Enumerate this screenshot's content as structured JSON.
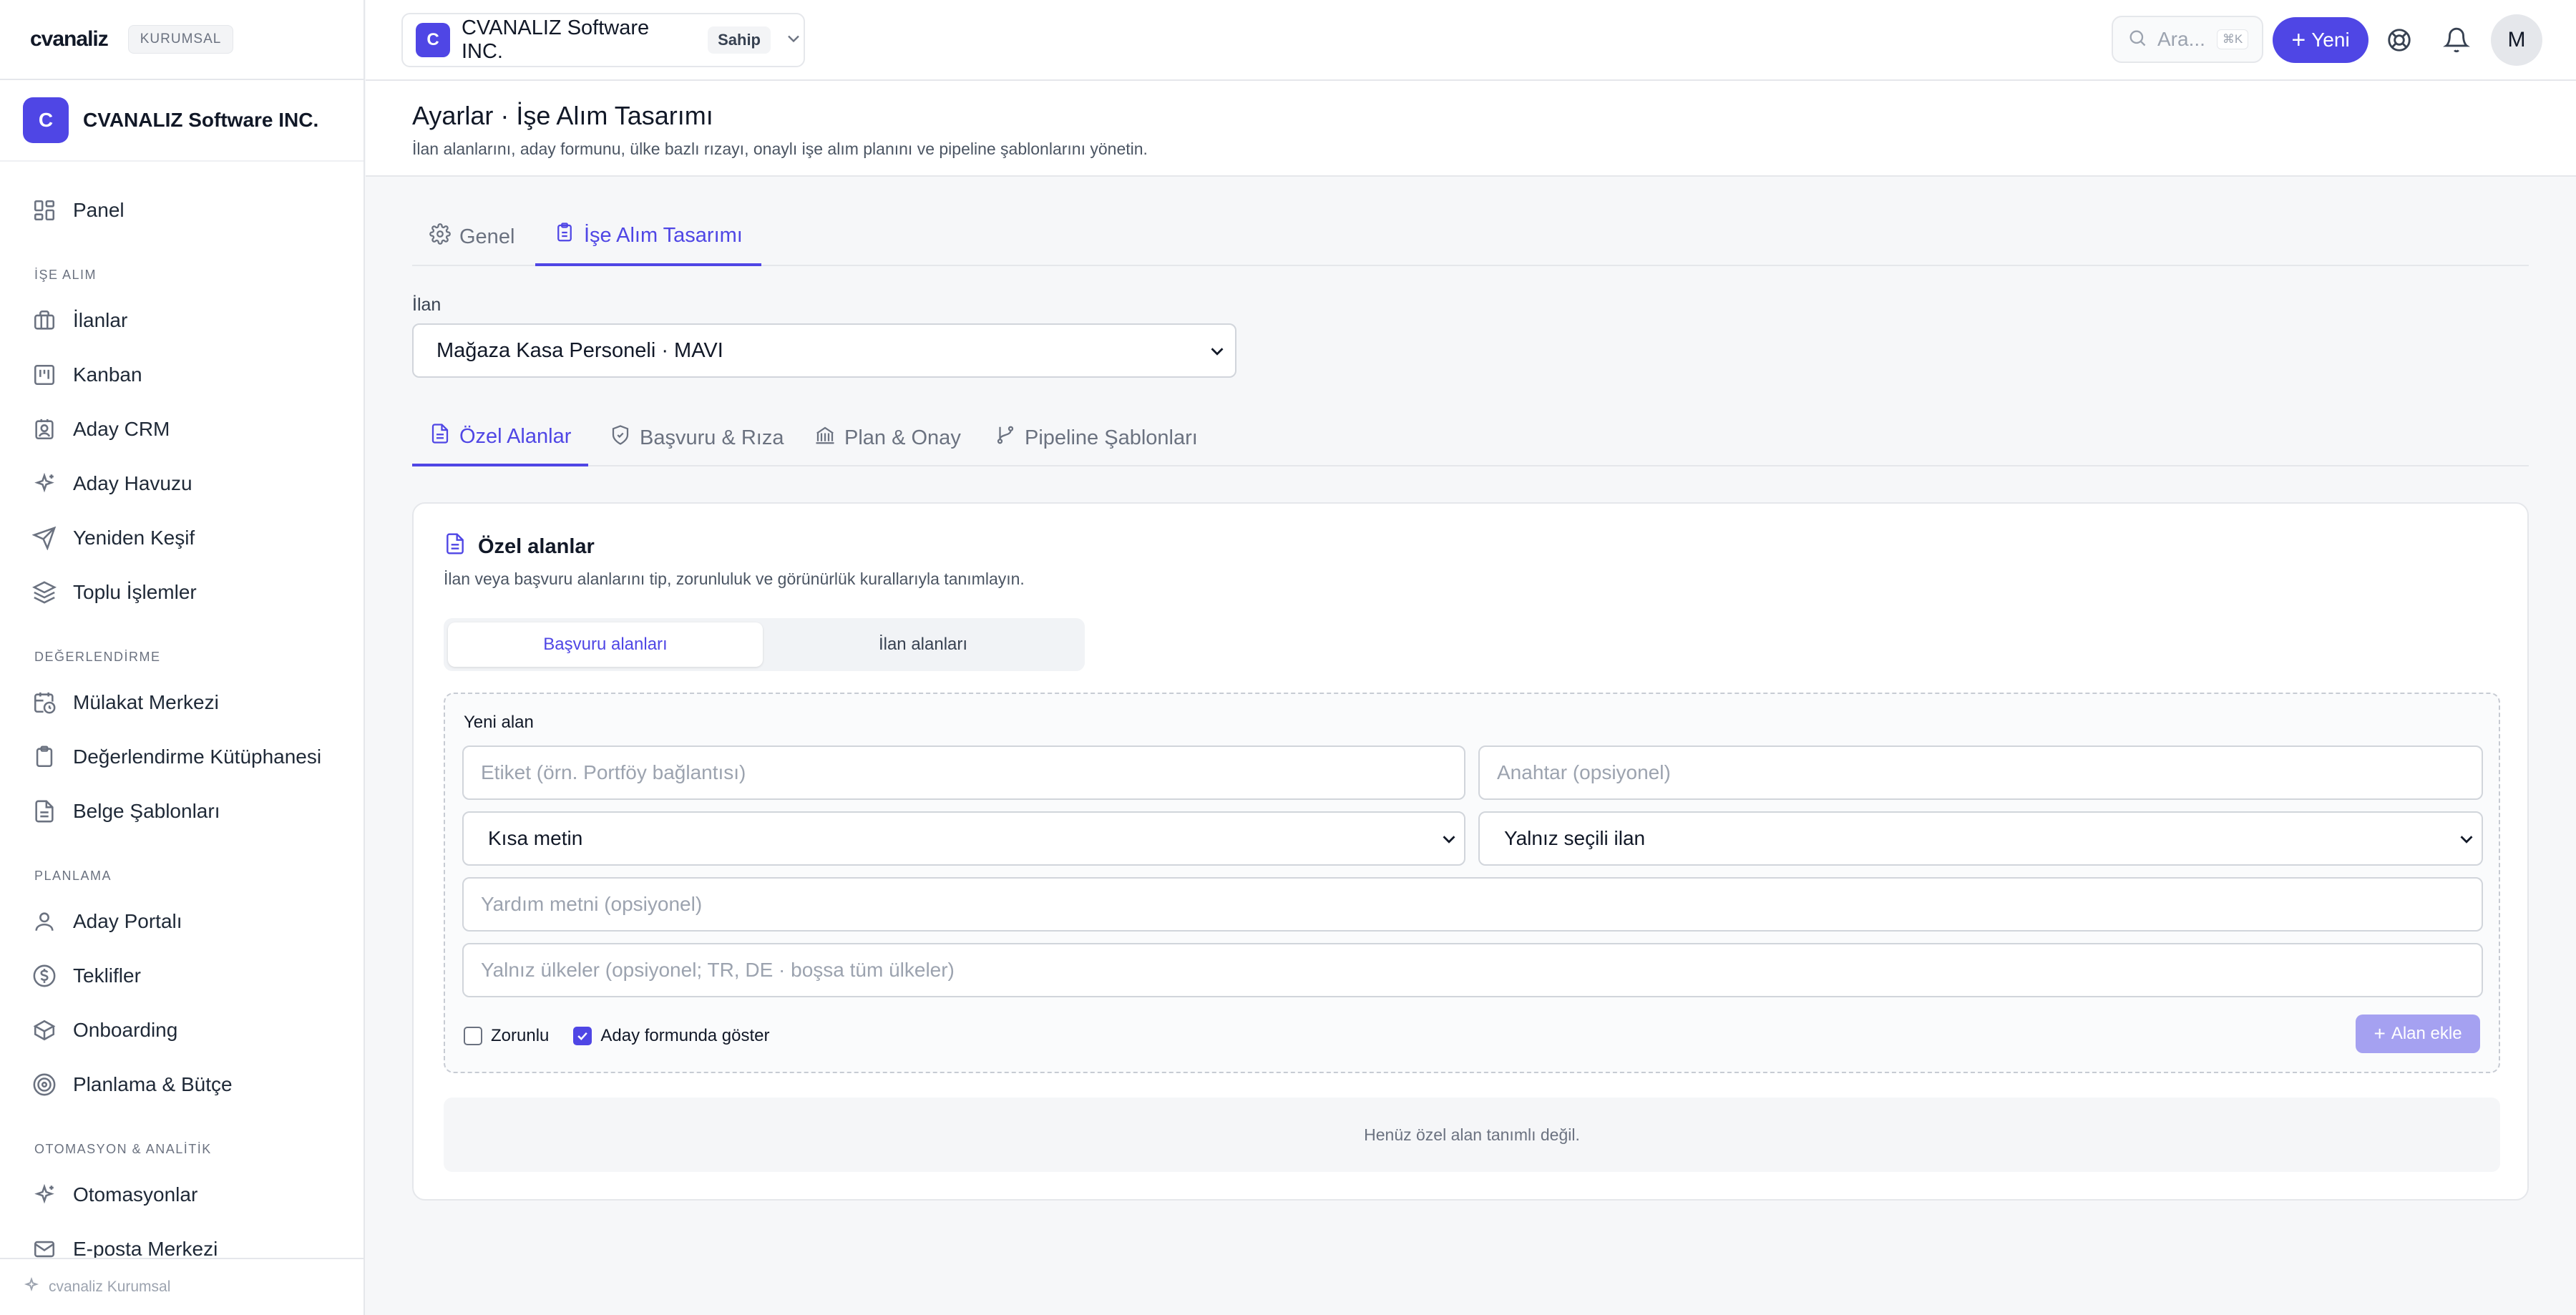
{
  "brand": {
    "logo_text": "cvanaliz",
    "badge": "KURUMSAL"
  },
  "org": {
    "initial": "C",
    "name": "CVANALIZ Software INC."
  },
  "sidebar": {
    "items": [
      {
        "label": "Panel",
        "icon": "grid-icon"
      },
      {
        "label": "İlanlar",
        "icon": "briefcase-icon"
      },
      {
        "label": "Kanban",
        "icon": "kanban-icon"
      },
      {
        "label": "Aday CRM",
        "icon": "contact-card-icon"
      },
      {
        "label": "Aday Havuzu",
        "icon": "sparkles-icon"
      },
      {
        "label": "Yeniden Keşif",
        "icon": "send-icon"
      },
      {
        "label": "Toplu İşlemler",
        "icon": "layers-icon"
      },
      {
        "label": "Mülakat Merkezi",
        "icon": "calendar-clock-icon"
      },
      {
        "label": "Değerlendirme Kütüphanesi",
        "icon": "clipboard-icon"
      },
      {
        "label": "Belge Şablonları",
        "icon": "document-icon"
      },
      {
        "label": "Aday Portalı",
        "icon": "user-icon"
      },
      {
        "label": "Teklifler",
        "icon": "dollar-circle-icon"
      },
      {
        "label": "Onboarding",
        "icon": "package-icon"
      },
      {
        "label": "Planlama & Bütçe",
        "icon": "target-icon"
      },
      {
        "label": "Otomasyonlar",
        "icon": "sparkles-icon"
      },
      {
        "label": "E-posta Merkezi",
        "icon": "mail-icon"
      }
    ],
    "sections": [
      "İŞE ALIM",
      "DEĞERLENDİRME",
      "PLANLAMA",
      "OTOMASYON & ANALİTİK"
    ],
    "footer": "cvanaliz Kurumsal"
  },
  "topbar": {
    "org_initial": "C",
    "org_name": "CVANALIZ Software INC.",
    "role": "Sahip",
    "search_placeholder": "Ara...",
    "search_shortcut": "⌘K",
    "new_label": "Yeni",
    "user_initial": "M"
  },
  "page": {
    "title": "Ayarlar · İşe Alım Tasarımı",
    "subtitle": "İlan alanlarını, aday formunu, ülke bazlı rızayı, onaylı işe alım planını ve pipeline şablonlarını yönetin."
  },
  "tabs": [
    "Genel",
    "İşe Alım Tasarımı"
  ],
  "ilan": {
    "label": "İlan",
    "selected": "Mağaza Kasa Personeli · MAVI"
  },
  "subtabs": [
    "Özel Alanlar",
    "Başvuru & Rıza",
    "Plan & Onay",
    "Pipeline Şablonları"
  ],
  "card": {
    "title": "Özel alanlar",
    "subtitle": "İlan veya başvuru alanlarını tip, zorunluluk ve görünürlük kurallarıyla tanımlayın.",
    "segments": [
      "Başvuru alanları",
      "İlan alanları"
    ],
    "new_field": {
      "title": "Yeni alan",
      "label_placeholder": "Etiket (örn. Portföy bağlantısı)",
      "key_placeholder": "Anahtar (opsiyonel)",
      "type_value": "Kısa metin",
      "scope_value": "Yalnız seçili ilan",
      "help_placeholder": "Yardım metni (opsiyonel)",
      "countries_placeholder": "Yalnız ülkeler (opsiyonel; TR, DE · boşsa tüm ülkeler)",
      "required_label": "Zorunlu",
      "required_checked": false,
      "show_label": "Aday formunda göster",
      "show_checked": true,
      "add_label": "Alan ekle"
    },
    "empty_text": "Henüz özel alan tanımlı değil."
  },
  "colors": {
    "accent": "#4f46e5",
    "accent_disabled": "#a5a1f1"
  }
}
